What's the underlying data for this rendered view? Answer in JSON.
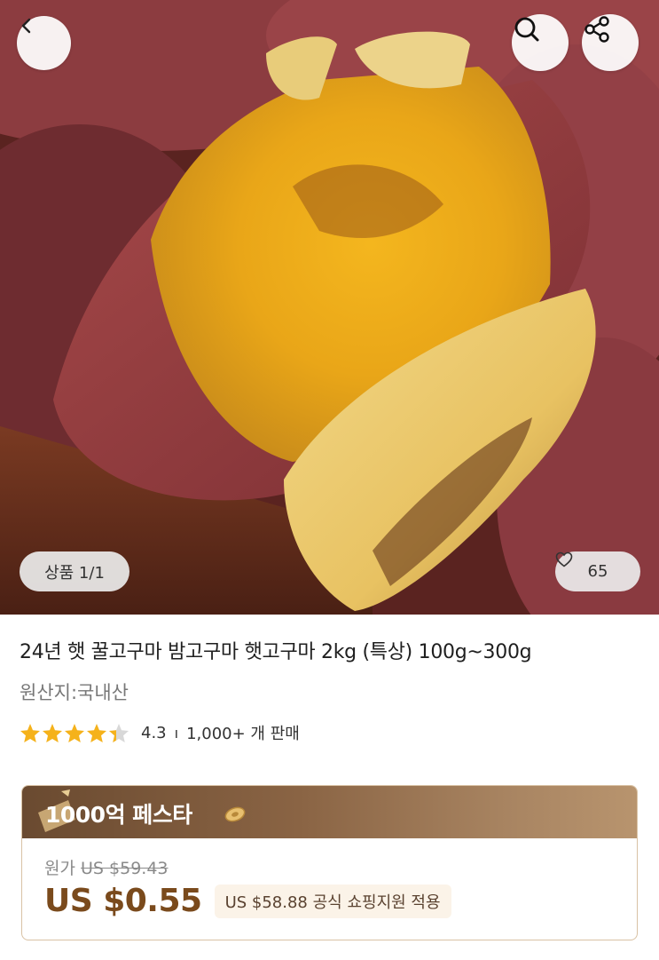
{
  "header": {
    "back_icon": "chevron-left-icon",
    "search_icon": "search-icon",
    "share_icon": "share-icon"
  },
  "gallery": {
    "counter": "상품 1/1",
    "likes": "65",
    "image_subject": "roasted-sweet-potato"
  },
  "product": {
    "title": "24년 햇 꿀고구마 밤고구마 햇고구마 2kg (특상) 100g~300g",
    "origin": "원산지:국내산",
    "rating": "4.3",
    "rating_value": 4.3,
    "rating_max": 5,
    "sales": "1,000+ 개 판매"
  },
  "promo": {
    "title": "1000억 페스타",
    "original_label": "원가",
    "original_price": "US $59.43",
    "sale_price": "US $0.55",
    "subsidy": "US $58.88 공식 쇼핑지원 적용"
  },
  "colors": {
    "accent_brown": "#7a4a1c",
    "star_gold": "#f5b21b",
    "promo_header": "#8a6444"
  }
}
